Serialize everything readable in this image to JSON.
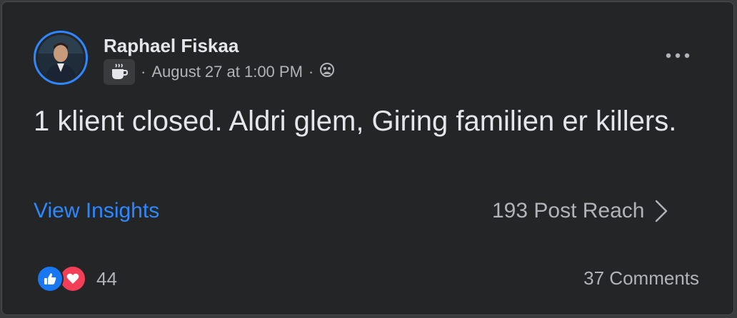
{
  "post": {
    "author": "Raphael Fiskaa",
    "date": "August 27 at 1:00 PM",
    "separator": "·",
    "text": "1 klient closed. Aldri glem, Giring familien er killers.",
    "feeling_icon": "coffee-cup-icon",
    "audience_icon": "friends-audience-icon"
  },
  "insights": {
    "link_label": "View Insights",
    "reach_label": "193 Post Reach"
  },
  "engagement": {
    "reaction_icons": [
      "like-icon",
      "love-icon"
    ],
    "reaction_count": "44",
    "comments_label": "37 Comments"
  },
  "colors": {
    "background": "#242526",
    "link": "#2d88ff",
    "like": "#1877f2",
    "love": "#f33e58"
  }
}
